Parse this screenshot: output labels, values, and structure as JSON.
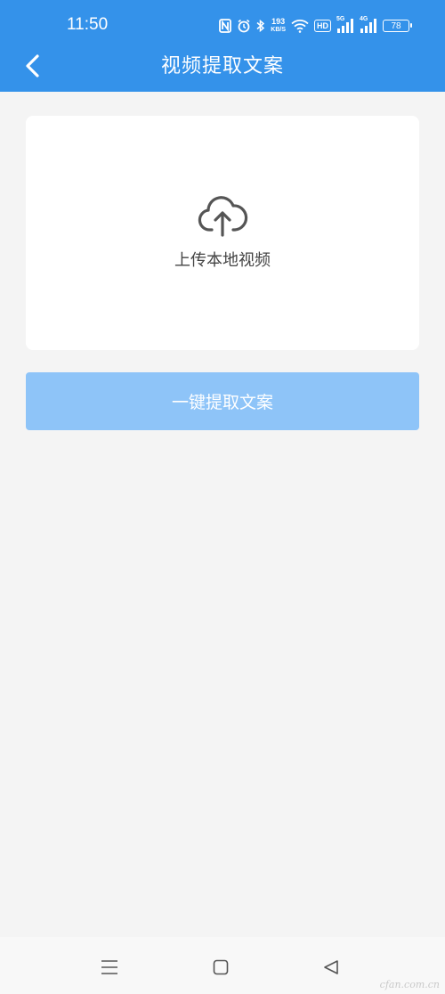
{
  "status_bar": {
    "time": "11:50",
    "network_speed_value": "193",
    "network_speed_unit": "KB/S",
    "hd_label": "HD",
    "signal1_label": "5G",
    "signal2_label": "4G",
    "battery": "78",
    "icons": [
      "nfc-icon",
      "alarm-icon",
      "bluetooth-icon",
      "wifi-icon",
      "signal-icon",
      "battery-icon"
    ]
  },
  "header": {
    "title": "视频提取文案",
    "back_icon": "chevron-left-icon"
  },
  "upload": {
    "icon": "cloud-upload-icon",
    "label": "上传本地视频"
  },
  "action": {
    "extract_label": "一键提取文案"
  },
  "nav": {
    "icons": [
      "menu-icon",
      "home-square-icon",
      "back-triangle-icon"
    ]
  },
  "watermark": "cfan.com.cn",
  "colors": {
    "header_bg": "#3492ea",
    "page_bg": "#f4f4f4",
    "button_bg": "#8ec4f8",
    "card_bg": "#ffffff",
    "label_text": "#444444"
  }
}
